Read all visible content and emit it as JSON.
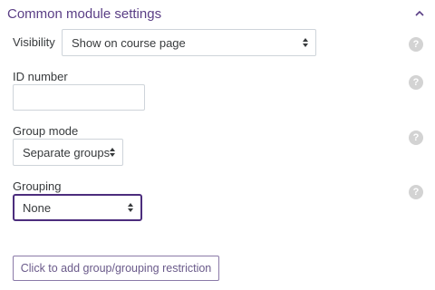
{
  "section": {
    "title": "Common module settings",
    "collapse_icon": "chevron-up-icon"
  },
  "visibility": {
    "label": "Visibility",
    "selected": "Show on course page"
  },
  "id_number": {
    "label": "ID number",
    "value": ""
  },
  "group_mode": {
    "label": "Group mode",
    "selected": "Separate groups"
  },
  "grouping": {
    "label": "Grouping",
    "selected": "None"
  },
  "help": {
    "glyph": "?",
    "icon": "help-icon"
  },
  "restriction_button": {
    "label": "Click to add group/grouping restriction"
  },
  "colors": {
    "title": "#5a3e85",
    "focus_border": "#4c2d7d",
    "help_icon_bg": "#d3d3d3",
    "button_border": "#8b7aa8"
  }
}
